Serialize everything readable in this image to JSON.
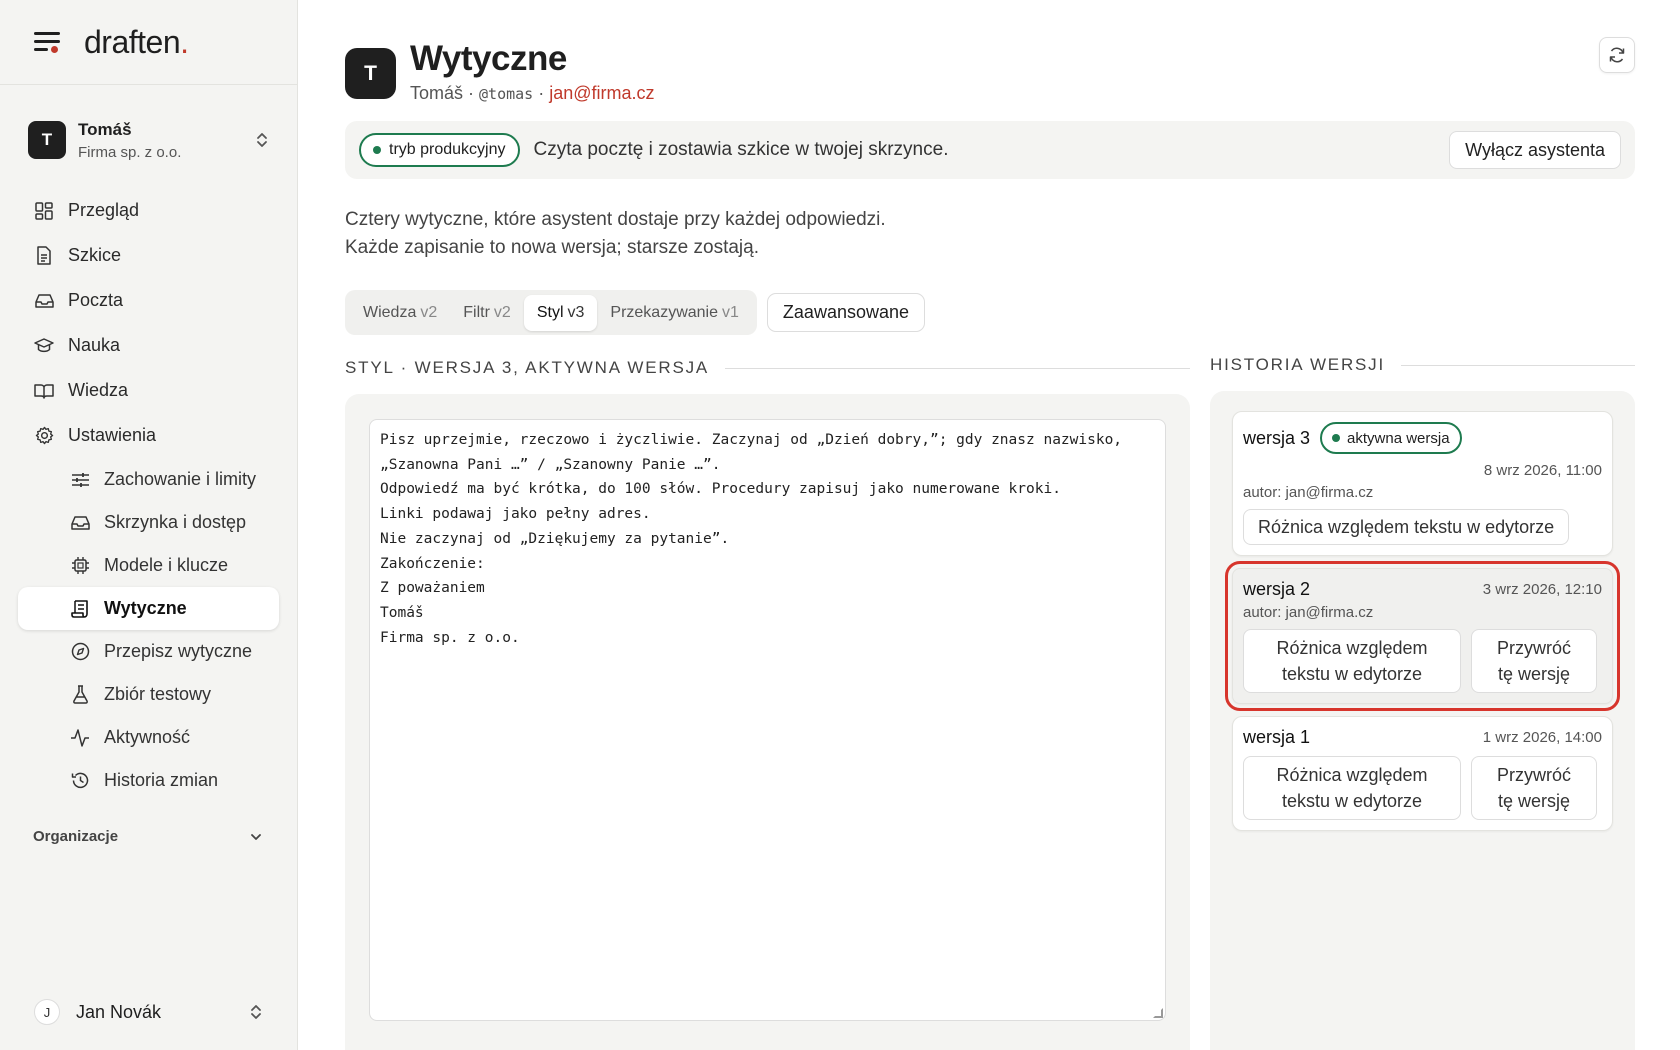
{
  "brand": {
    "name": "draften",
    "dot": "."
  },
  "account": {
    "initial": "T",
    "name": "Tomáš",
    "org": "Firma sp. z o.o."
  },
  "nav": {
    "items": [
      {
        "label": "Przegląd",
        "icon": "dashboard-icon"
      },
      {
        "label": "Szkice",
        "icon": "document-icon"
      },
      {
        "label": "Poczta",
        "icon": "inbox-icon"
      },
      {
        "label": "Nauka",
        "icon": "graduation-cap-icon"
      },
      {
        "label": "Wiedza",
        "icon": "book-icon"
      },
      {
        "label": "Ustawienia",
        "icon": "gear-icon"
      }
    ],
    "sub_items": [
      {
        "label": "Zachowanie i limity",
        "icon": "sliders-icon"
      },
      {
        "label": "Skrzynka i dostęp",
        "icon": "inbox-icon"
      },
      {
        "label": "Modele i klucze",
        "icon": "chip-icon"
      },
      {
        "label": "Wytyczne",
        "icon": "scroll-icon",
        "active": true
      },
      {
        "label": "Przepisz wytyczne",
        "icon": "compass-icon"
      },
      {
        "label": "Zbiór testowy",
        "icon": "flask-icon"
      },
      {
        "label": "Aktywność",
        "icon": "activity-icon"
      },
      {
        "label": "Historia zmian",
        "icon": "history-icon"
      }
    ],
    "organizations_label": "Organizacje"
  },
  "user": {
    "initial": "J",
    "name": "Jan Novák"
  },
  "header": {
    "initial": "T",
    "title": "Wytyczne",
    "name": "Tomáš",
    "handle": "@tomas",
    "email": "jan@firma.cz",
    "sep": " · "
  },
  "banner": {
    "mode_label": "tryb produkcyjny",
    "text": "Czyta pocztę i zostawia szkice w twojej skrzynce.",
    "disable_button": "Wyłącz asystenta"
  },
  "intro": {
    "line1": "Cztery wytyczne, które asystent dostaje przy każdej odpowiedzi.",
    "line2": "Każde zapisanie to nowa wersja; starsze zostają."
  },
  "tabs": [
    {
      "label": "Wiedza",
      "version": "v2"
    },
    {
      "label": "Filtr",
      "version": "v2"
    },
    {
      "label": "Styl",
      "version": "v3",
      "active": true
    },
    {
      "label": "Przekazywanie",
      "version": "v1"
    }
  ],
  "advanced_button": "Zaawansowane",
  "editor": {
    "section_title": "Styl · wersja 3, aktywna wersja",
    "lines": [
      "Pisz uprzejmie, rzeczowo i życzliwie. Zaczynaj od „Dzień dobry,”; gdy znasz nazwisko,",
      "„Szanowna Pani …” / „Szanowny Panie …”.",
      "Odpowiedź ma być krótka, do 100 słów. Procedury zapisuj jako numerowane kroki.",
      "Linki podawaj jako pełny adres.",
      "Nie zaczynaj od „Dziękujemy za pytanie”.",
      "Zakończenie:",
      "Z poważaniem",
      "Tomáš",
      "Firma sp. z o.o."
    ]
  },
  "history": {
    "section_title": "Historia wersji",
    "versions": [
      {
        "name": "wersja 3",
        "active_label": "aktywna wersja",
        "date": "8 wrz 2026, 11:00",
        "author": "autor: jan@firma.cz",
        "diff_label": "Różnica względem tekstu w edytorze"
      },
      {
        "name": "wersja 2",
        "date": "3 wrz 2026, 12:10",
        "author": "autor: jan@firma.cz",
        "diff_label_1": "Różnica względem",
        "diff_label_2": "tekstu w edytorze",
        "restore_label_1": "Przywróć",
        "restore_label_2": "tę wersję"
      },
      {
        "name": "wersja 1",
        "date": "1 wrz 2026, 14:00",
        "diff_label_1": "Różnica względem",
        "diff_label_2": "tekstu w edytorze",
        "restore_label_1": "Przywróć",
        "restore_label_2": "tę wersję"
      }
    ]
  }
}
